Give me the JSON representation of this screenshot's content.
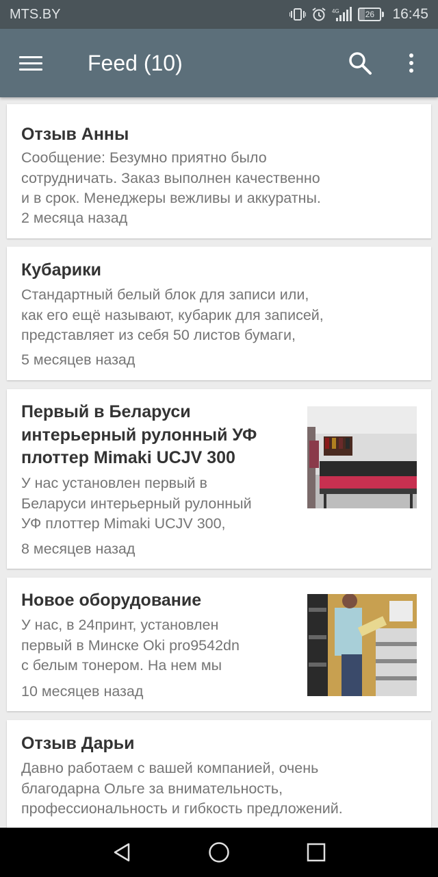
{
  "status_bar": {
    "carrier": "MTS.BY",
    "battery_level": "26",
    "time": "16:45"
  },
  "toolbar": {
    "title": "Feed (10)"
  },
  "feed": [
    {
      "title": "Отзыв Анны",
      "text_lines": [
        "Сообщение: Безумно приятно было",
        "сотрудничать. Заказ выполнен качественно",
        "и в срок. Менеджеры вежливы и аккуратны."
      ],
      "time": "2 месяца назад"
    },
    {
      "title": "Кубарики",
      "text_lines": [
        "Стандартный белый блок для записи или,",
        "как его ещё называют, кубарик для записей,",
        "представляет из себя 50 листов бумаги,"
      ],
      "time": "5 месяцев назад"
    },
    {
      "title_lines": [
        "Первый в Беларуси",
        "интерьерный рулонный УФ",
        "плоттер Mimaki UCJV 300"
      ],
      "text_lines": [
        "У нас установлен первый в",
        "Беларуси интерьерный рулонный",
        "УФ плоттер Mimaki UCJV 300,"
      ],
      "time": "8 месяцев назад"
    },
    {
      "title": "Новое оборудование",
      "text_lines": [
        "У нас, в 24принт, установлен",
        "первый в Минске Oki pro9542dn",
        "с белым тонером. На нем мы"
      ],
      "time": "10 месяцев назад"
    },
    {
      "title": "Отзыв Дарьи",
      "text_lines": [
        "Давно работаем с вашей компанией, очень",
        "благодарна Ольге за внимательность,",
        "профессиональность и гибкость предложений."
      ]
    }
  ]
}
